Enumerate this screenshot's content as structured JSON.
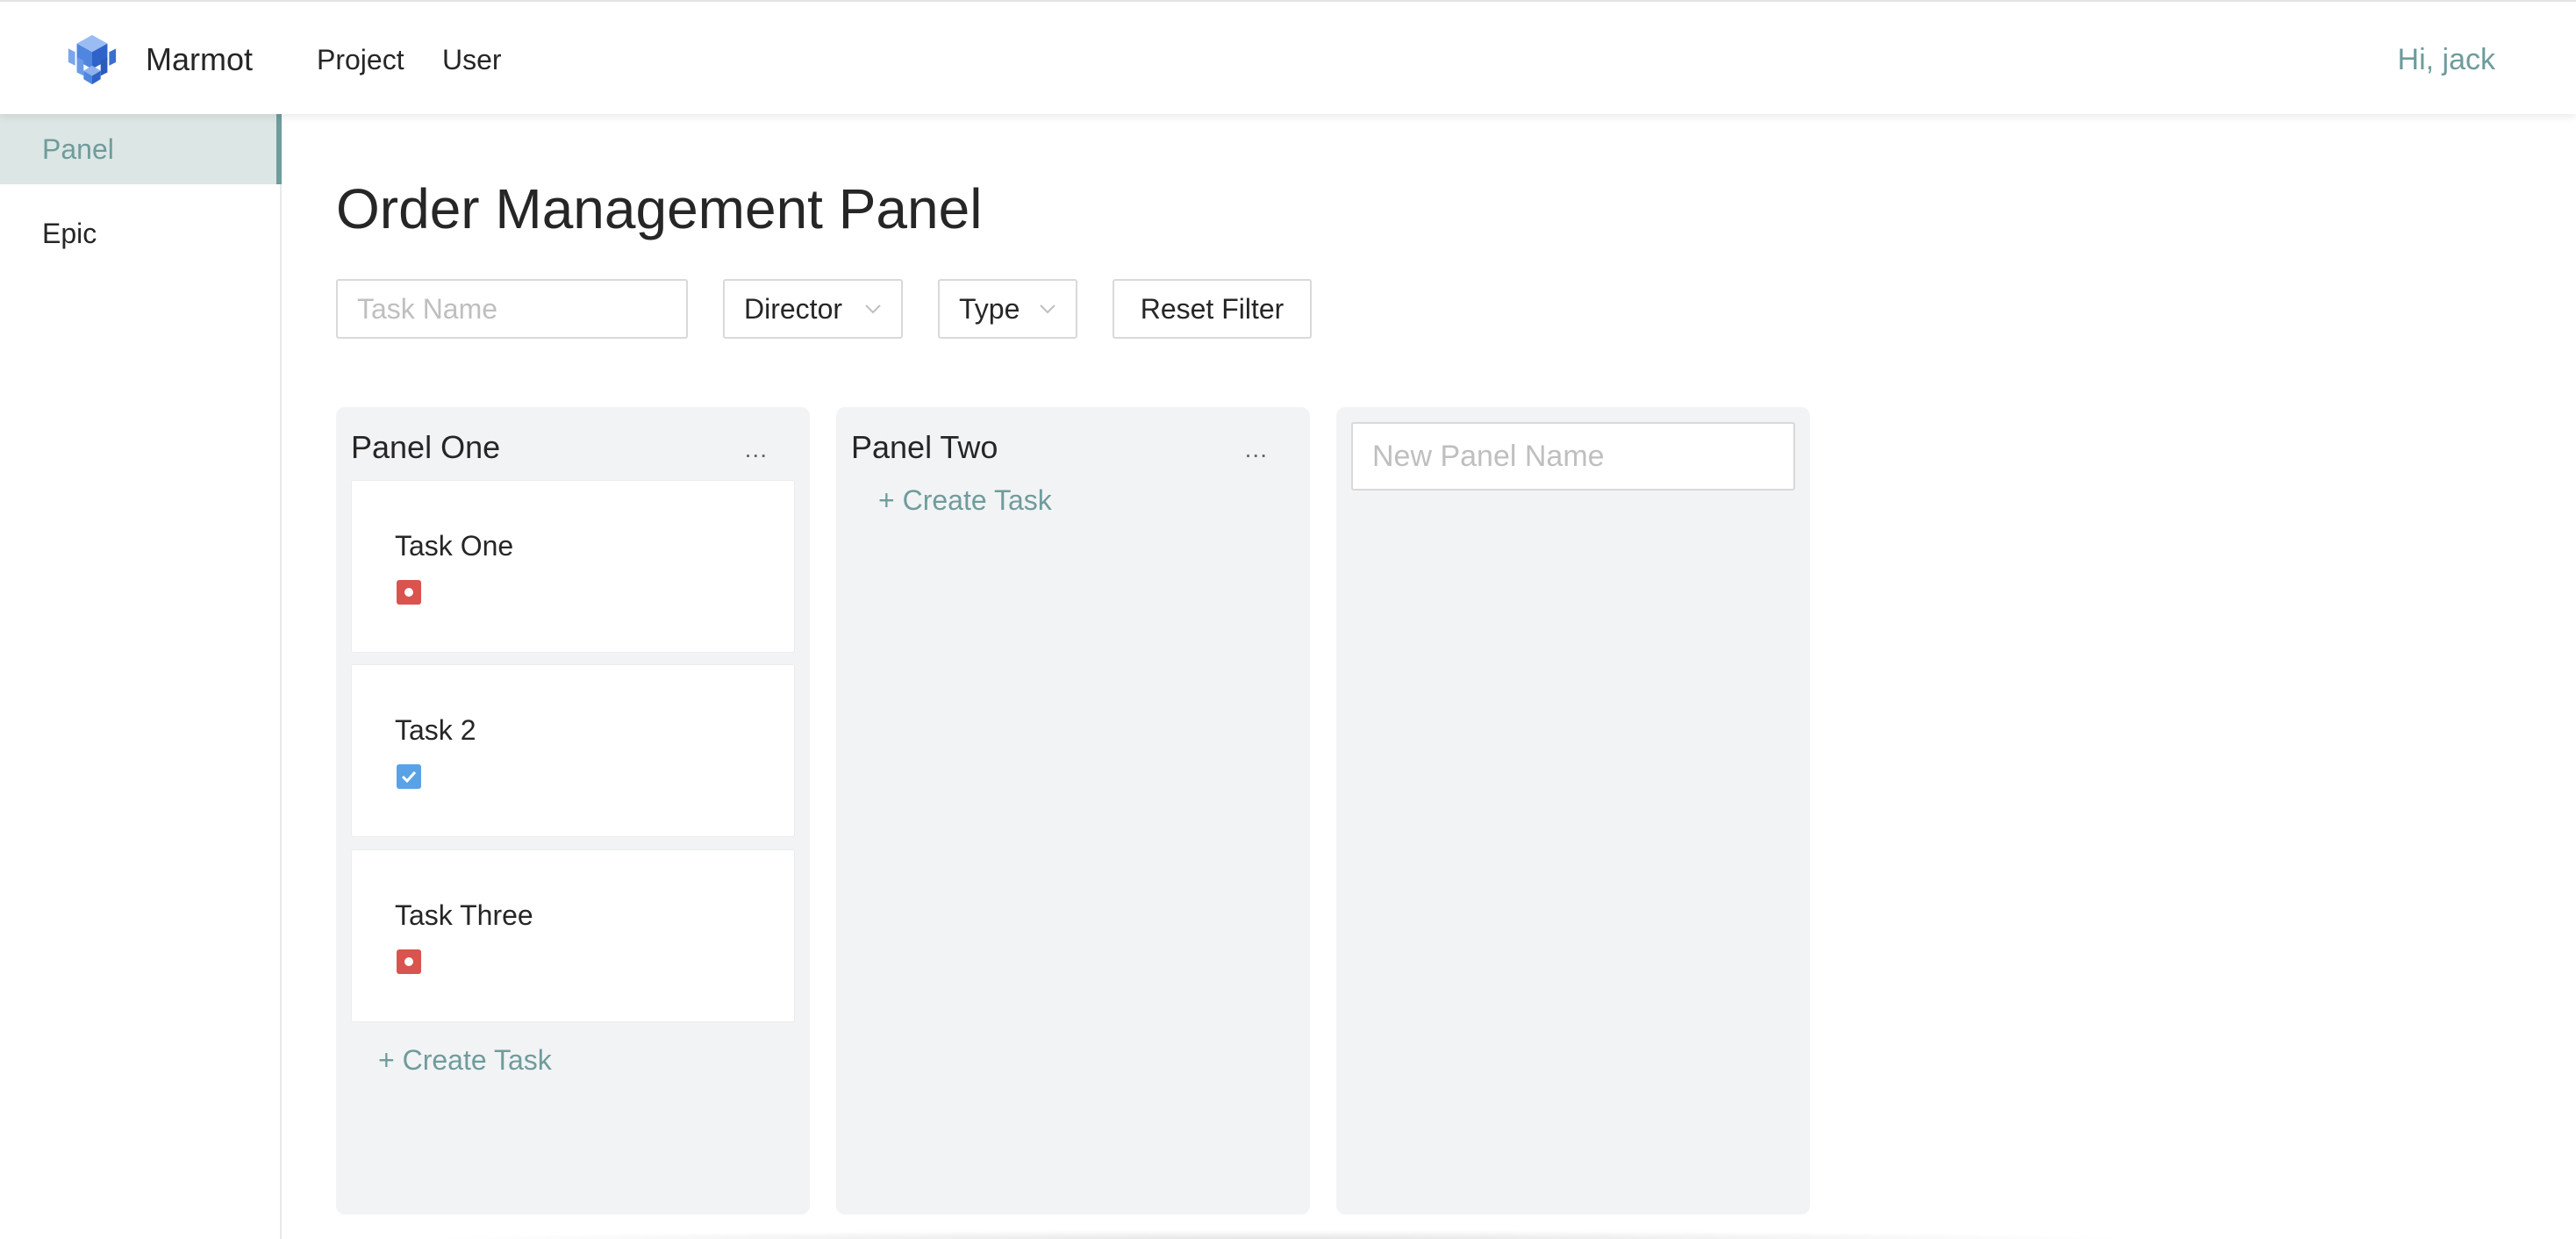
{
  "header": {
    "brand": "Marmot",
    "nav": [
      {
        "label": "Project"
      },
      {
        "label": "User"
      }
    ],
    "greeting": "Hi, jack",
    "logo_icon": "cube-stack-logo-icon"
  },
  "sidebar": {
    "items": [
      {
        "label": "Panel",
        "active": true
      },
      {
        "label": "Epic",
        "active": false
      }
    ]
  },
  "main": {
    "title": "Order Management Panel",
    "filters": {
      "task_name_placeholder": "Task Name",
      "director_label": "Director",
      "type_label": "Type",
      "reset_label": "Reset Filter"
    },
    "columns": [
      {
        "title": "Panel One",
        "more": "...",
        "tasks": [
          {
            "name": "Task One",
            "type_icon": "bug-icon"
          },
          {
            "name": "Task 2",
            "type_icon": "task-check-icon"
          },
          {
            "name": "Task Three",
            "type_icon": "bug-icon"
          }
        ],
        "create_label": "+ Create Task"
      },
      {
        "title": "Panel Two",
        "more": "...",
        "tasks": [],
        "create_label": "+ Create Task"
      }
    ],
    "new_panel_placeholder": "New Panel Name"
  },
  "colors": {
    "accent": "#6f9c9c",
    "sidebar_active_bg": "#dce6e4",
    "column_bg": "#f2f3f5",
    "bug_red": "#d9534f",
    "task_blue": "#5aa2e6"
  }
}
